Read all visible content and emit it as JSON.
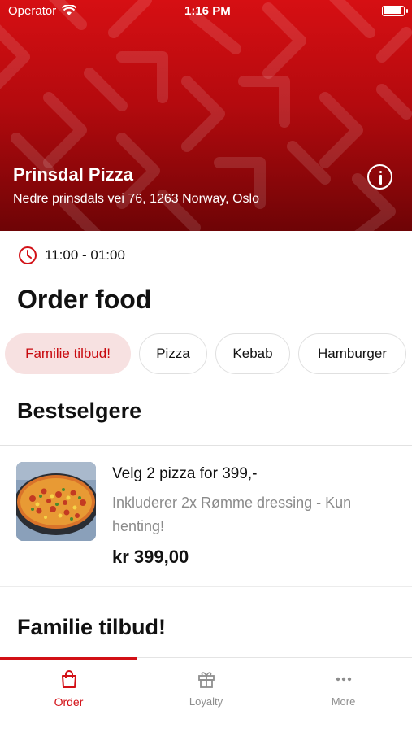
{
  "status_bar": {
    "carrier": "Operator",
    "time": "1:16 PM"
  },
  "restaurant": {
    "name": "Prinsdal Pizza",
    "address": "Nedre prinsdals vei 76, 1263 Norway, Oslo",
    "hours": "11:00 - 01:00"
  },
  "main": {
    "order_title": "Order food",
    "categories": [
      {
        "label": "Familie tilbud!",
        "active": true
      },
      {
        "label": "Pizza",
        "active": false
      },
      {
        "label": "Kebab",
        "active": false
      },
      {
        "label": "Hamburger",
        "active": false
      }
    ],
    "bestsellers_title": "Bestselgere",
    "products": [
      {
        "name": "Velg 2 pizza for 399,-",
        "description": "Inkluderer 2x Rømme dressing - Kun henting!",
        "price": "kr 399,00"
      }
    ],
    "family_title": "Familie tilbud!"
  },
  "tab_bar": {
    "tabs": [
      {
        "label": "Order",
        "icon": "shopping-bag-icon",
        "active": true
      },
      {
        "label": "Loyalty",
        "icon": "gift-icon",
        "active": false
      },
      {
        "label": "More",
        "icon": "more-dots-icon",
        "active": false
      }
    ]
  },
  "colors": {
    "accent": "#d21016",
    "chip_active_bg": "#f7e1e1",
    "header_top": "#d60f13",
    "header_bottom": "#6e0406"
  }
}
